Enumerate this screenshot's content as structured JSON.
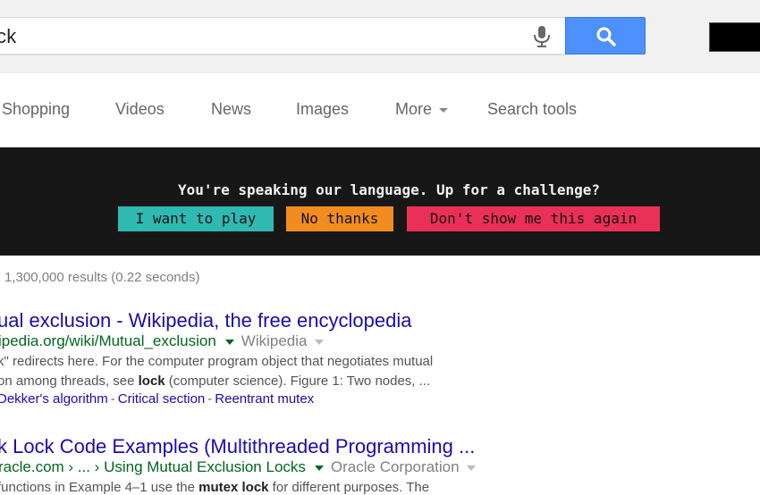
{
  "search": {
    "query": "ck"
  },
  "tabs": [
    {
      "label": "Shopping"
    },
    {
      "label": "Videos"
    },
    {
      "label": "News"
    },
    {
      "label": "Images"
    },
    {
      "label": "More"
    },
    {
      "label": "Search tools"
    }
  ],
  "banner": {
    "text": "You're speaking our language. Up for a challenge?",
    "play_label": "I want to play",
    "no_thanks_label": "No thanks",
    "dont_show_label": "Don't show me this again",
    "colors": {
      "background": "#171717",
      "play": "#2fb9b3",
      "no_thanks": "#f28c1e",
      "dont_show": "#ea3057"
    }
  },
  "results": {
    "stats": "1,300,000 results (0.22 seconds)",
    "items": [
      {
        "title": "ual exclusion - Wikipedia, the free encyclopedia",
        "url": "ipedia.org/wiki/Mutual_exclusion",
        "source": "Wikipedia",
        "snippet_1a": "k\" redirects here. For the computer program object that negotiates mutual",
        "snippet_2a": "on among threads, see ",
        "snippet_2b": "lock",
        "snippet_2c": " (computer science). Figure 1: Two nodes,  ...",
        "links": [
          "Dekker's algorithm",
          "Critical section",
          "Reentrant mutex"
        ],
        "link_separator": "-"
      },
      {
        "title": "k Lock Code Examples (Multithreaded Programming ...",
        "url": "racle.com › ... › Using Mutual Exclusion Locks",
        "source": "Oracle Corporation",
        "snippet_1a": "functions in Example 4–1 use the ",
        "snippet_1b": "mutex lock",
        "snippet_1c": " for different purposes. The"
      }
    ]
  },
  "colors": {
    "link": "#1a0dab",
    "url": "#006621",
    "search_button": "#4d90fe"
  }
}
